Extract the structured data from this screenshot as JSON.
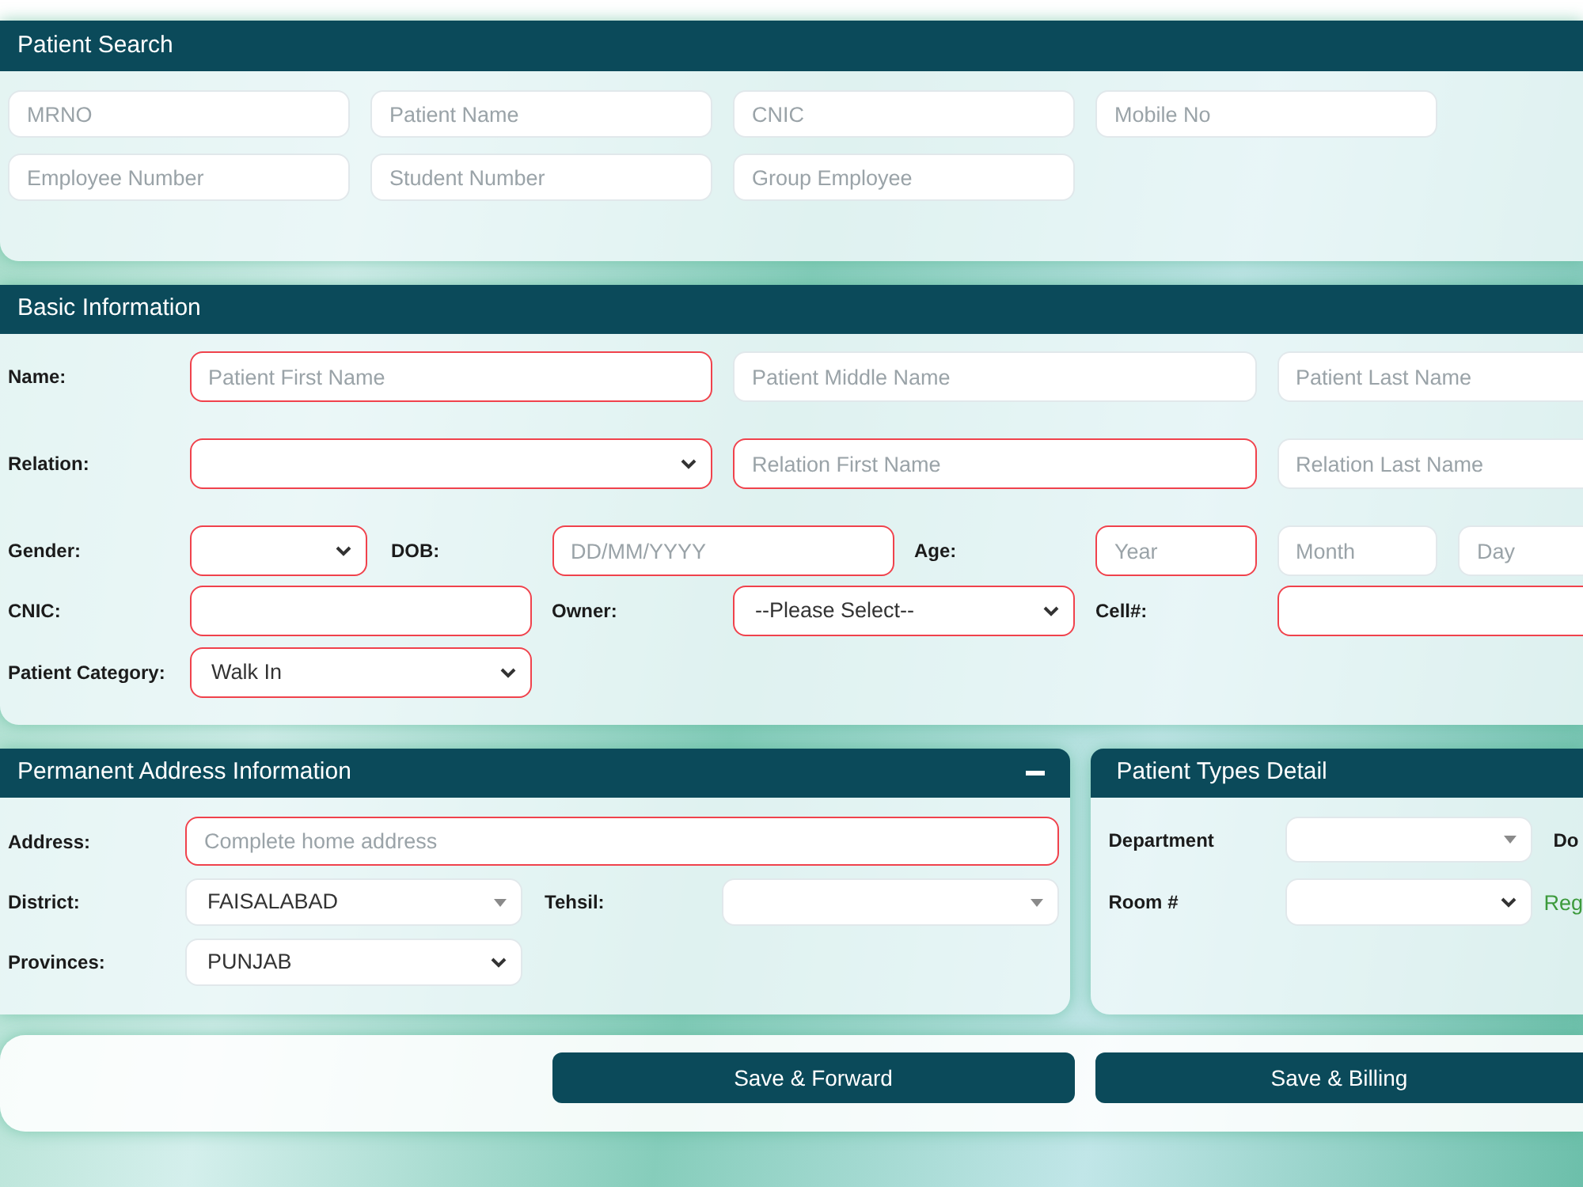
{
  "patient_search": {
    "title": "Patient Search",
    "fields": [
      {
        "placeholder": "MRNO"
      },
      {
        "placeholder": "Patient Name"
      },
      {
        "placeholder": "CNIC"
      },
      {
        "placeholder": "Mobile No"
      },
      {
        "placeholder": "Employee Number"
      },
      {
        "placeholder": "Student Number"
      },
      {
        "placeholder": "Group Employee"
      }
    ]
  },
  "basic_information": {
    "title": "Basic Information",
    "rows": [
      {
        "items": [
          {
            "kind": "label",
            "text": "Name:"
          },
          {
            "kind": "input",
            "placeholder": "Patient First Name",
            "required": true
          },
          {
            "kind": "input",
            "placeholder": "Patient Middle Name",
            "required": false
          },
          {
            "kind": "input",
            "placeholder": "Patient Last Name",
            "required": false
          }
        ]
      },
      {
        "items": [
          {
            "kind": "label",
            "text": "Relation:"
          },
          {
            "kind": "select",
            "required": true
          },
          {
            "kind": "input",
            "placeholder": "Relation First Name",
            "required": true
          },
          {
            "kind": "input",
            "placeholder": "Relation Last Name",
            "required": false
          }
        ]
      },
      {
        "items": [
          {
            "kind": "label",
            "text": "Gender:"
          },
          {
            "kind": "select",
            "required": true
          },
          {
            "kind": "label",
            "text": "DOB:"
          },
          {
            "kind": "input",
            "placeholder": "DD/MM/YYYY",
            "required": true
          },
          {
            "kind": "label",
            "text": "Age:"
          },
          {
            "kind": "input",
            "placeholder": "Year",
            "required": true
          },
          {
            "kind": "input",
            "placeholder": "Month",
            "required": false
          },
          {
            "kind": "input",
            "placeholder": "Day",
            "required": false
          }
        ]
      },
      {
        "items": [
          {
            "kind": "label",
            "text": "CNIC:"
          },
          {
            "kind": "input",
            "required": true
          },
          {
            "kind": "label",
            "text": "Owner:"
          },
          {
            "kind": "select",
            "value": "--Please Select--",
            "required": true
          },
          {
            "kind": "label",
            "text": "Cell#:"
          },
          {
            "kind": "input",
            "required": true
          }
        ]
      },
      {
        "items": [
          {
            "kind": "label",
            "text": "Patient Category:"
          },
          {
            "kind": "select",
            "value": "Walk In",
            "required": true
          }
        ]
      }
    ]
  },
  "permanent_address": {
    "title": "Permanent Address Information",
    "fields": [
      {
        "label": "Address:",
        "kind": "input",
        "placeholder": "Complete home address",
        "required": true
      },
      {
        "label": "District:",
        "kind": "combobox",
        "value": "FAISALABAD",
        "required": false
      },
      {
        "label": "Tehsil:",
        "kind": "combobox",
        "required": false
      },
      {
        "label": "Provinces:",
        "kind": "select",
        "value": "PUNJAB",
        "required": false
      }
    ]
  },
  "patient_types": {
    "title": "Patient Types Detail",
    "rows": [
      {
        "label": "Department",
        "control": {
          "kind": "combobox",
          "required": false
        },
        "side": {
          "kind": "label",
          "text": "Do"
        }
      },
      {
        "label": "Room #",
        "control": {
          "kind": "select",
          "required": false
        },
        "side": {
          "kind": "status",
          "text": "Reg"
        }
      }
    ]
  },
  "buttons": [
    "Save & Forward",
    "Save & Billing"
  ]
}
